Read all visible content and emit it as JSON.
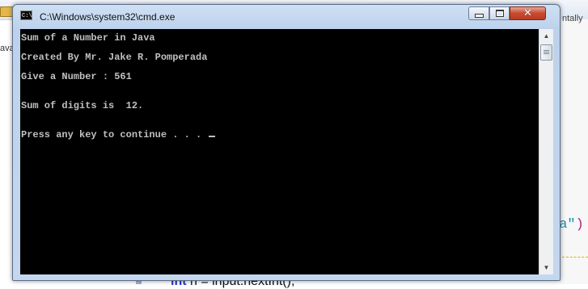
{
  "window": {
    "title": "C:\\Windows\\system32\\cmd.exe",
    "icon": "cmd-icon",
    "icon_text": "C:\\"
  },
  "console": {
    "lines": [
      "Sum of a Number in Java",
      "Created By Mr. Jake R. Pomperada",
      "Give a Number : 561",
      "Sum of digits is  12.",
      "Press any key to continue . . . "
    ]
  },
  "background": {
    "right_text_1": "ntally",
    "right_text_2": "da\"",
    "right_text_2_paren": ")",
    "left_text": "ava",
    "bottom_code_kw": "int",
    "bottom_code": " n = input.nextInt();"
  },
  "colors": {
    "console_bg": "#000000",
    "console_fg": "#c0c0c0",
    "close_button": "#c84a30"
  }
}
